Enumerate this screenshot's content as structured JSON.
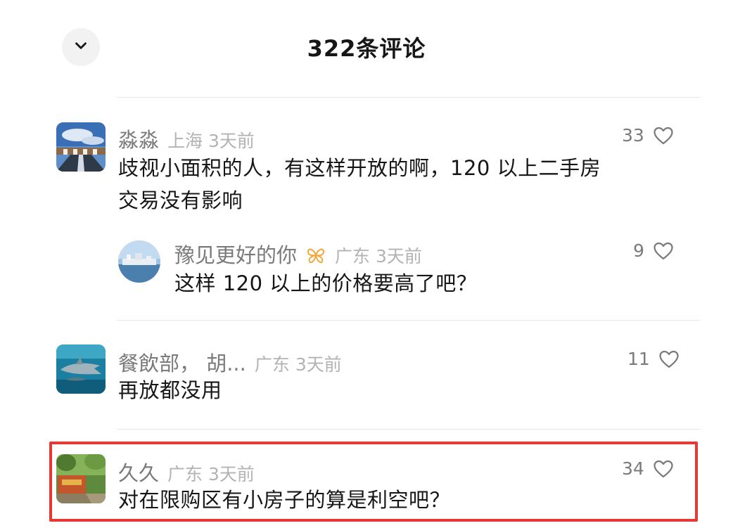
{
  "header": {
    "title": "322条评论",
    "collapse_icon": "chevron-down-icon"
  },
  "comments": [
    {
      "username": "淼淼",
      "location": "上海",
      "time": "3天前",
      "likes": "33",
      "text_line1": "歧视小面积的人，有这样开放的啊，120 以上二手房",
      "text_line2": "交易没有影响",
      "avatar": "sky-building-avatar",
      "reply": {
        "username": "豫见更好的你",
        "badge": "butterfly-badge-icon",
        "location": "广东",
        "time": "3天前",
        "likes": "9",
        "text": "这样 120 以上的价格要高了吧？",
        "avatar": "harbor-avatar"
      }
    },
    {
      "username": "餐飲部，  胡...",
      "location": "广东",
      "time": "3天前",
      "likes": "11",
      "text": "再放都没用",
      "avatar": "shark-avatar"
    },
    {
      "username": "久久",
      "location": "广东",
      "time": "3天前",
      "likes": "34",
      "text": "对在限购区有小房子的算是利空吧？",
      "avatar": "garden-gate-avatar",
      "highlighted": true
    }
  ],
  "colors": {
    "highlight": "#e53935",
    "badge": "#f2a93b"
  }
}
